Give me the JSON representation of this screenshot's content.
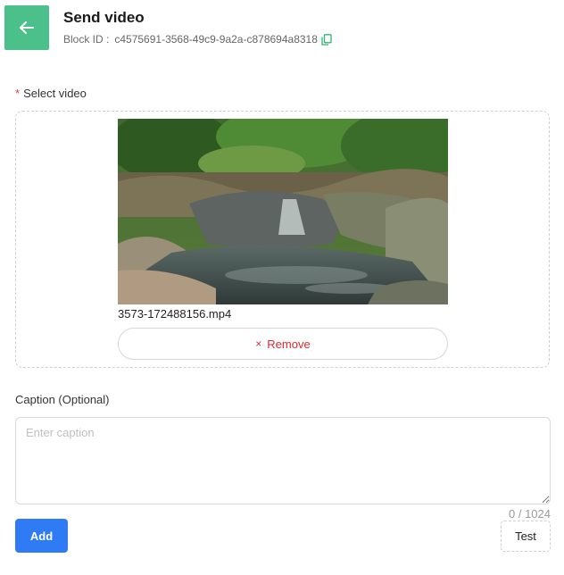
{
  "header": {
    "title": "Send video",
    "block_id_label": "Block ID :",
    "block_id_value": "c4575691-3568-49c9-9a2a-c878694a8318",
    "accent_color": "#4cc08a"
  },
  "icons": {
    "back": "arrow-left-icon",
    "copy": "copy-icon",
    "remove": "close-icon"
  },
  "select_video": {
    "required_mark": "*",
    "label": "Select video",
    "file_name": "3573-172488156.mp4",
    "remove_icon": "×",
    "remove_label": "Remove"
  },
  "caption": {
    "label": "Caption (Optional)",
    "placeholder": "Enter caption",
    "value": "",
    "counter": "0 / 1024"
  },
  "actions": {
    "add_label": "Add",
    "test_label": "Test",
    "add_color": "#2f7bf5",
    "remove_color": "#e0282e"
  }
}
